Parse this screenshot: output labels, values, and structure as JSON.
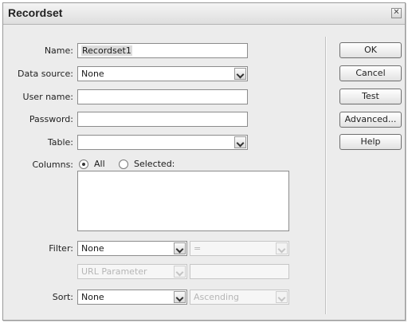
{
  "dialog": {
    "title": "Recordset",
    "close_glyph": "✕"
  },
  "form": {
    "name": {
      "label": "Name:",
      "value": "Recordset1"
    },
    "data_source": {
      "label": "Data source:",
      "value": "None"
    },
    "user_name": {
      "label": "User name:",
      "value": ""
    },
    "password": {
      "label": "Password:",
      "value": ""
    },
    "table": {
      "label": "Table:",
      "value": ""
    },
    "columns": {
      "label": "Columns:",
      "options": [
        {
          "label": "All",
          "selected": true
        },
        {
          "label": "Selected:",
          "selected": false
        }
      ],
      "items": []
    },
    "filter": {
      "label": "Filter:",
      "column": "None",
      "operator": "=",
      "value": "",
      "param_type": "URL Parameter",
      "param_value": ""
    },
    "sort": {
      "label": "Sort:",
      "column": "None",
      "order": "Ascending"
    }
  },
  "buttons": {
    "ok": "OK",
    "cancel": "Cancel",
    "test": "Test",
    "advanced": "Advanced...",
    "help": "Help"
  },
  "icons": [
    "close-icon",
    "chevron-down-icon"
  ],
  "colors": {
    "window_bg": "#ececec",
    "field_border": "#8c8c8c",
    "disabled_text": "#b6b6b6"
  }
}
